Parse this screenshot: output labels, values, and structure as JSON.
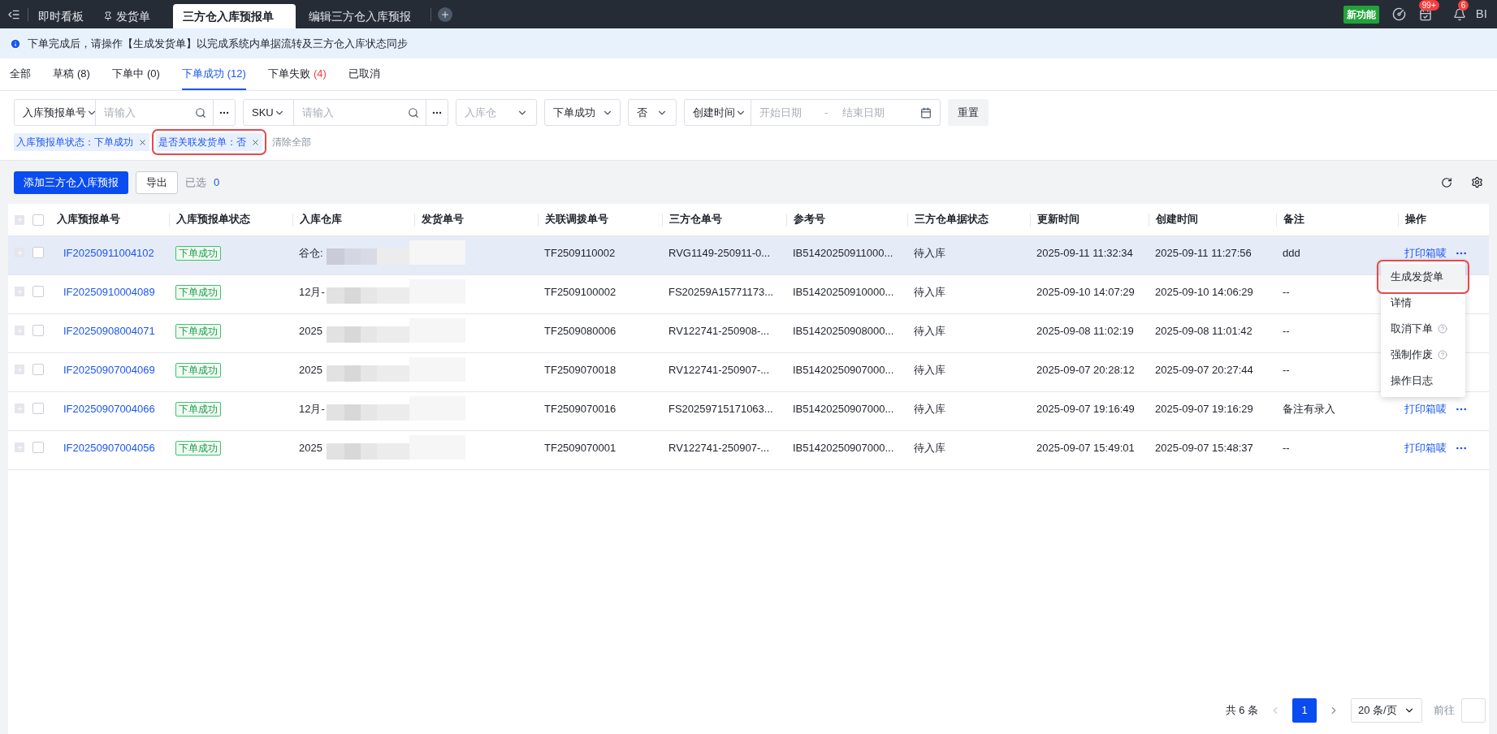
{
  "top_bar": {
    "tabs": [
      {
        "label": "即时看板",
        "pinned": false,
        "selected": false
      },
      {
        "label": "发货单",
        "pinned": true,
        "selected": false
      },
      {
        "label": "三方仓入库预报单",
        "pinned": false,
        "selected": true
      },
      {
        "label": "编辑三方仓入库预报",
        "pinned": false,
        "selected": false
      }
    ],
    "new_feature_badge": "新功能",
    "task_count": "99+",
    "notification_count": "6",
    "bi_label": "BI"
  },
  "banner": {
    "text": "下单完成后，请操作【生成发货单】以完成系统内单据流转及三方仓入库状态同步"
  },
  "status_tabs": [
    {
      "label": "全部",
      "selected": false
    },
    {
      "label": "草稿",
      "count": "(8)",
      "selected": false,
      "alert": false
    },
    {
      "label": "下单中",
      "count": "(0)",
      "selected": false,
      "alert": false
    },
    {
      "label": "下单成功",
      "count": "(12)",
      "selected": true,
      "alert": false
    },
    {
      "label": "下单失败",
      "count": "(4)",
      "selected": false,
      "alert": true
    },
    {
      "label": "已取消",
      "selected": false
    }
  ],
  "filters": {
    "search_groups": [
      {
        "field": "入库预报单号",
        "placeholder": "请输入"
      },
      {
        "field": "SKU",
        "placeholder": "请输入"
      }
    ],
    "selects": [
      {
        "placeholder": "入库仓"
      },
      {
        "value": "下单成功"
      },
      {
        "value": "否"
      }
    ],
    "date_range": {
      "field": "创建时间",
      "start_placeholder": "开始日期",
      "separator": "-",
      "end_placeholder": "结束日期"
    },
    "reset_button": "重置",
    "chips": [
      {
        "label": "入库预报单状态：下单成功",
        "annotated": false
      },
      {
        "label": "是否关联发货单：否",
        "annotated": true
      }
    ],
    "clear_all": "清除全部"
  },
  "toolbar": {
    "add_button": "添加三方仓入库预报",
    "export_button": "导出",
    "selected_label": "已选",
    "selected_count": "0"
  },
  "table": {
    "header_checked": false,
    "columns": [
      "入库预报单号",
      "入库预报单状态",
      "入库仓库",
      "发货单号",
      "关联调拨单号",
      "三方仓单号",
      "参考号",
      "三方仓单据状态",
      "更新时间",
      "创建时间",
      "备注",
      "操作"
    ],
    "rows": [
      {
        "id": "IF20250911004102",
        "status": "下单成功",
        "warehouse": "谷仓:",
        "transfer": "TF2509110002",
        "wms_no": "RVG1149-250911-0...",
        "ref": "IB51420250911000...",
        "wms_status": "待入库",
        "updated": "2025-09-11 11:32:34",
        "created": "2025-09-11 11:27:56",
        "note": "ddd",
        "action": "打印箱唛",
        "checked": false,
        "highlighted": true
      },
      {
        "id": "IF20250910004089",
        "status": "下单成功",
        "warehouse": "12月-",
        "transfer": "TF2509100002",
        "wms_no": "FS20259A15771173...",
        "ref": "IB51420250910000...",
        "wms_status": "待入库",
        "updated": "2025-09-10 14:07:29",
        "created": "2025-09-10 14:06:29",
        "note": "--",
        "checked": false,
        "highlighted": false
      },
      {
        "id": "IF20250908004071",
        "status": "下单成功",
        "warehouse": "2025",
        "transfer": "TF2509080006",
        "wms_no": "RV122741-250908-...",
        "ref": "IB51420250908000...",
        "wms_status": "待入库",
        "updated": "2025-09-08 11:02:19",
        "created": "2025-09-08 11:01:42",
        "note": "--",
        "checked": false,
        "highlighted": false
      },
      {
        "id": "IF20250907004069",
        "status": "下单成功",
        "warehouse": "2025",
        "transfer": "TF2509070018",
        "wms_no": "RV122741-250907-...",
        "ref": "IB51420250907000...",
        "wms_status": "待入库",
        "updated": "2025-09-07 20:28:12",
        "created": "2025-09-07 20:27:44",
        "note": "--",
        "checked": false,
        "highlighted": false
      },
      {
        "id": "IF20250907004066",
        "status": "下单成功",
        "warehouse": "12月-",
        "transfer": "TF2509070016",
        "wms_no": "FS20259715171063...",
        "ref": "IB51420250907000...",
        "wms_status": "待入库",
        "updated": "2025-09-07 19:16:49",
        "created": "2025-09-07 19:16:29",
        "note": "备注有录入",
        "action": "打印箱唛",
        "checked": false,
        "highlighted": false
      },
      {
        "id": "IF20250907004056",
        "status": "下单成功",
        "warehouse": "2025",
        "transfer": "TF2509070001",
        "wms_no": "RV122741-250907-...",
        "ref": "IB51420250907000...",
        "wms_status": "待入库",
        "updated": "2025-09-07 15:49:01",
        "created": "2025-09-07 15:48:37",
        "note": "--",
        "action": "打印箱唛",
        "checked": false,
        "highlighted": false
      }
    ]
  },
  "action_menu": {
    "items": [
      {
        "label": "生成发货单",
        "help": false,
        "highlighted": true,
        "annotated": true
      },
      {
        "label": "详情",
        "help": false,
        "highlighted": false,
        "annotated": false
      },
      {
        "label": "取消下单",
        "help": true,
        "highlighted": false,
        "annotated": false
      },
      {
        "label": "强制作废",
        "help": true,
        "highlighted": false,
        "annotated": false
      },
      {
        "label": "操作日志",
        "help": false,
        "highlighted": false,
        "annotated": false
      }
    ]
  },
  "pagination": {
    "total": "共 6 条",
    "pages": [
      {
        "label": "1",
        "selected": true
      }
    ],
    "page_size": "20 条/页",
    "goto_label": "前往"
  }
}
